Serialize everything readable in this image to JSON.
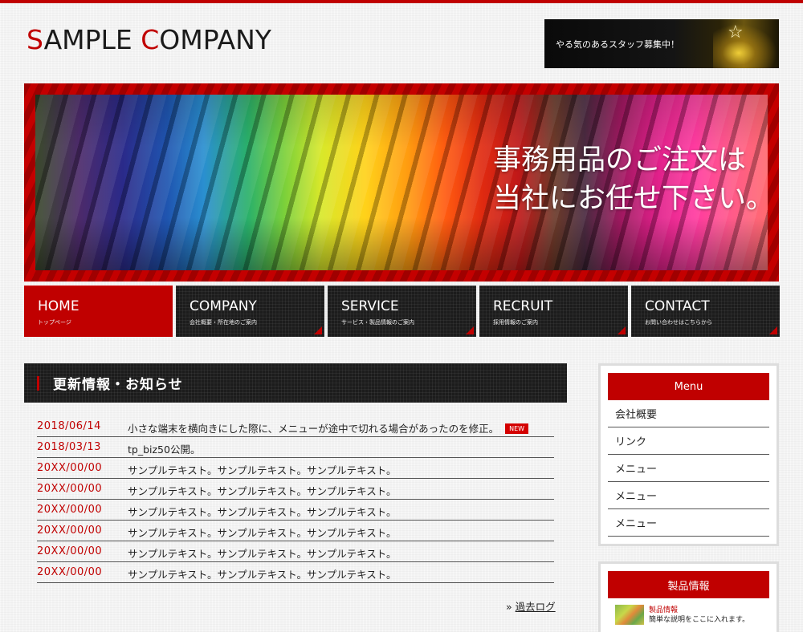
{
  "header": {
    "logo_s": "S",
    "logo_ample": "AMPLE ",
    "logo_c": "C",
    "logo_ompany": "OMPANY",
    "recruit_banner": "やる気のあるスタッフ募集中！"
  },
  "hero": {
    "catch_line1": "事務用品のご注文は",
    "catch_line2": "当社にお任せ下さい。"
  },
  "nav": [
    {
      "label": "HOME",
      "sub": "トップページ"
    },
    {
      "label": "COMPANY",
      "sub": "会社概要・所在地のご案内"
    },
    {
      "label": "SERVICE",
      "sub": "サービス・製品情報のご案内"
    },
    {
      "label": "RECRUIT",
      "sub": "採用情報のご案内"
    },
    {
      "label": "CONTACT",
      "sub": "お問い合わせはこちらから"
    }
  ],
  "news": {
    "heading": "更新情報・お知らせ",
    "new_badge": "NEW",
    "items": [
      {
        "date": "2018/06/14",
        "text": "小さな端末を横向きにした際に、メニューが途中で切れる場合があったのを修正。"
      },
      {
        "date": "2018/03/13",
        "text": "tp_biz50公開。"
      },
      {
        "date": "20XX/00/00",
        "text": "サンプルテキスト。サンプルテキスト。サンプルテキスト。"
      },
      {
        "date": "20XX/00/00",
        "text": "サンプルテキスト。サンプルテキスト。サンプルテキスト。"
      },
      {
        "date": "20XX/00/00",
        "text": "サンプルテキスト。サンプルテキスト。サンプルテキスト。"
      },
      {
        "date": "20XX/00/00",
        "text": "サンプルテキスト。サンプルテキスト。サンプルテキスト。"
      },
      {
        "date": "20XX/00/00",
        "text": "サンプルテキスト。サンプルテキスト。サンプルテキスト。"
      },
      {
        "date": "20XX/00/00",
        "text": "サンプルテキスト。サンプルテキスト。サンプルテキスト。"
      }
    ],
    "past_log_prefix": "»",
    "past_log": "過去ログ"
  },
  "sidebar": {
    "menu_title": "Menu",
    "menu_items": [
      "会社概要",
      "リンク",
      "メニュー",
      "メニュー",
      "メニュー"
    ],
    "products_title": "製品情報",
    "product_name": "製品情報",
    "product_desc": "簡単な説明をここに入れます。"
  },
  "colors": {
    "accent": "#c00000",
    "nav_bg": "#1c1c1c",
    "page_bg": "#f3f3f3"
  }
}
